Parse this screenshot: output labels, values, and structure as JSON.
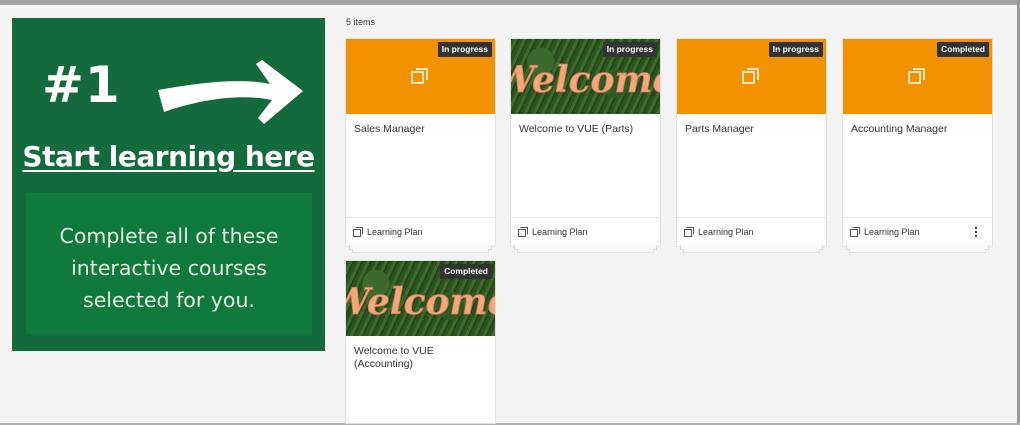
{
  "promo": {
    "number": "#1",
    "link": "Start learning here",
    "description": "Complete all of these interactive courses selected for you."
  },
  "items_count": "5 items",
  "cards": [
    {
      "title": "Sales Manager",
      "status": "In progress",
      "type": "Learning Plan",
      "thumb": "orange"
    },
    {
      "title": "Welcome to VUE (Parts)",
      "status": "In progress",
      "type": "Learning Plan",
      "thumb": "welcome",
      "art_text": "Welcome"
    },
    {
      "title": "Parts Manager",
      "status": "In progress",
      "type": "Learning Plan",
      "thumb": "orange"
    },
    {
      "title": "Accounting Manager",
      "status": "Completed",
      "type": "Learning Plan",
      "thumb": "orange"
    },
    {
      "title": "Welcome to VUE (Accounting)",
      "status": "Completed",
      "type": "",
      "thumb": "welcome",
      "art_text": "Welcome"
    }
  ],
  "colors": {
    "promo_bg": "#126a3d",
    "promo_box": "#0f7a3b",
    "thumb_orange": "#f39200",
    "badge_bg": "#333333"
  },
  "icons": {
    "course_thumb": "stacked-pages-icon",
    "plan": "stacked-pages-icon",
    "menu": "kebab-menu-icon",
    "arrow": "arrow-right-icon"
  }
}
